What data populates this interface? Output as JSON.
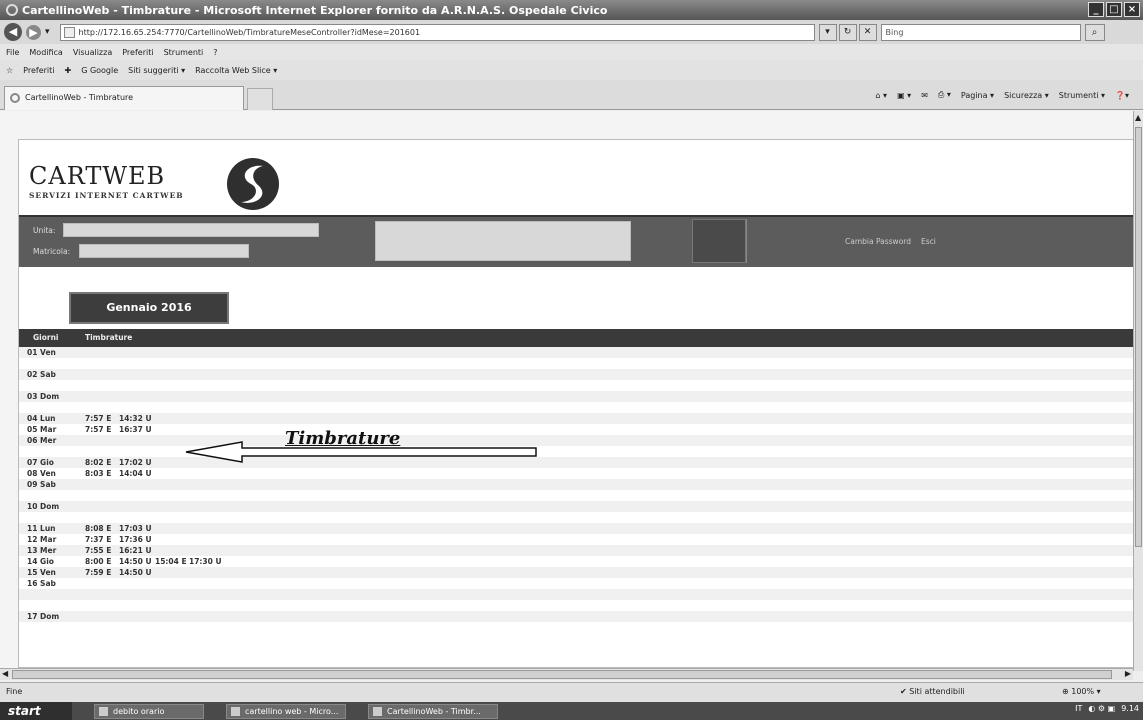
{
  "browser": {
    "title": "CartellinoWeb - Timbrature - Microsoft Internet Explorer fornito da A.R.N.A.S. Ospedale Civico",
    "url": "http://172.16.65.254:7770/CartellinoWeb/TimbratureMeseController?idMese=201601",
    "search_placeholder": "Bing",
    "menu": [
      "File",
      "Modifica",
      "Visualizza",
      "Preferiti",
      "Strumenti",
      "?"
    ],
    "favorites": {
      "preferiti": "Preferiti",
      "google": "G Google",
      "suggested": "Siti suggeriti ▾",
      "webslice": "Raccolta Web Slice ▾"
    },
    "tab_title": "CartellinoWeb - Timbrature",
    "commands": [
      "Pagina ▾",
      "Sicurezza ▾",
      "Strumenti ▾"
    ]
  },
  "site": {
    "logo_title": "CARTWEB",
    "logo_subtitle": "SERVIZI INTERNET CARTWEB",
    "unita_label": "Unita:",
    "matricola_label": "Matricola:",
    "link_password": "Cambia Password",
    "link_exit": "Esci"
  },
  "month_label": "Gennaio 2016",
  "columns": {
    "giorni": "Giorni",
    "timbrature": "Timbrature"
  },
  "annotation": "Timbrature",
  "rows": [
    {
      "day": "01 Ven",
      "stamps": []
    },
    {
      "day": "",
      "stamps": []
    },
    {
      "day": "02 Sab",
      "stamps": []
    },
    {
      "day": "",
      "stamps": []
    },
    {
      "day": "03 Dom",
      "stamps": []
    },
    {
      "day": "",
      "stamps": []
    },
    {
      "day": "04 Lun",
      "stamps": [
        "7:57 E",
        "14:32 U"
      ]
    },
    {
      "day": "05 Mar",
      "stamps": [
        "7:57 E",
        "16:37 U"
      ]
    },
    {
      "day": "06 Mer",
      "stamps": []
    },
    {
      "day": "",
      "stamps": []
    },
    {
      "day": "07 Gio",
      "stamps": [
        "8:02 E",
        "17:02 U"
      ]
    },
    {
      "day": "08 Ven",
      "stamps": [
        "8:03 E",
        "14:04 U"
      ]
    },
    {
      "day": "09 Sab",
      "stamps": []
    },
    {
      "day": "",
      "stamps": []
    },
    {
      "day": "10 Dom",
      "stamps": []
    },
    {
      "day": "",
      "stamps": []
    },
    {
      "day": "11 Lun",
      "stamps": [
        "8:08 E",
        "17:03 U"
      ]
    },
    {
      "day": "12 Mar",
      "stamps": [
        "7:37 E",
        "17:36 U"
      ]
    },
    {
      "day": "13 Mer",
      "stamps": [
        "7:55 E",
        "16:21 U"
      ]
    },
    {
      "day": "14 Gio",
      "stamps": [
        "8:00 E",
        "14:50 U",
        "15:04 E",
        "17:30 U"
      ]
    },
    {
      "day": "15 Ven",
      "stamps": [
        "7:59 E",
        "14:50 U"
      ]
    },
    {
      "day": "16 Sab",
      "stamps": []
    },
    {
      "day": "",
      "stamps": []
    },
    {
      "day": "",
      "stamps": []
    },
    {
      "day": "17 Dom",
      "stamps": []
    }
  ],
  "status": {
    "left": "Fine",
    "zone": "Siti attendibili",
    "zoom": "100%"
  },
  "taskbar": {
    "start": "start",
    "tasks": [
      "debito orario",
      "cartellino web - Micro...",
      "CartellinoWeb - Timbr..."
    ],
    "lang": "IT",
    "clock": "9.14"
  }
}
